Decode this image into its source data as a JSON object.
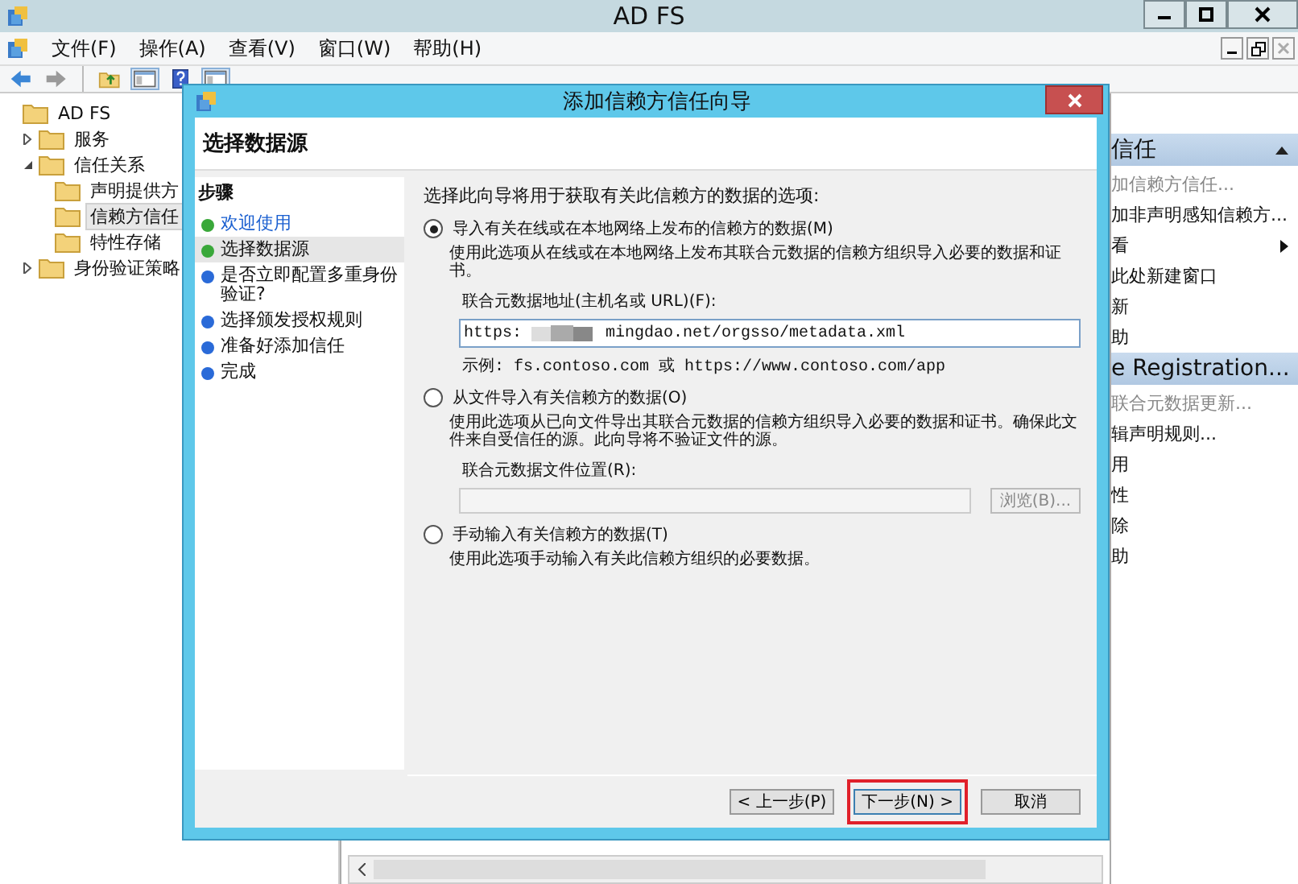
{
  "window": {
    "title": "AD FS"
  },
  "menu": [
    "文件(F)",
    "操作(A)",
    "查看(V)",
    "窗口(W)",
    "帮助(H)"
  ],
  "toolbar": [
    {
      "kind": "back"
    },
    {
      "kind": "forward"
    },
    {
      "kind": "up"
    },
    {
      "kind": "pane"
    },
    {
      "kind": "help"
    },
    {
      "kind": "pane"
    }
  ],
  "tree": [
    {
      "label": "AD FS",
      "selected": false,
      "children": [
        {
          "label": "服务",
          "expanded": false,
          "selected": false
        },
        {
          "label": "信任关系",
          "expanded": true,
          "selected": false,
          "children": [
            {
              "label": "声明提供方",
              "selected": false
            },
            {
              "label": "信赖方信任",
              "selected": true
            },
            {
              "label": "特性存储",
              "selected": false
            }
          ]
        },
        {
          "label": "身份验证策略",
          "expanded": false,
          "selected": false
        }
      ]
    }
  ],
  "actions": [
    {
      "title": "信任",
      "items": [
        {
          "label": "加信赖方信任...",
          "disabled": true,
          "submenu": false
        },
        {
          "label": "加非声明感知信赖方...",
          "disabled": false,
          "submenu": false
        },
        {
          "label": "看",
          "disabled": false,
          "submenu": true
        },
        {
          "label": "此处新建窗口",
          "disabled": false,
          "submenu": false
        },
        {
          "label": "新",
          "disabled": false,
          "submenu": false
        },
        {
          "label": "助",
          "disabled": false,
          "submenu": false
        }
      ]
    },
    {
      "title": "e Registration...",
      "items": [
        {
          "label": "联合元数据更新...",
          "disabled": true,
          "submenu": false
        },
        {
          "label": "辑声明规则...",
          "disabled": false,
          "submenu": false
        },
        {
          "label": "用",
          "disabled": false,
          "submenu": false
        },
        {
          "label": "性",
          "disabled": false,
          "submenu": false
        },
        {
          "label": "除",
          "disabled": false,
          "submenu": false
        },
        {
          "label": "助",
          "disabled": false,
          "submenu": false
        }
      ]
    }
  ],
  "dialog": {
    "title": "添加信赖方信任向导",
    "heading": "选择数据源",
    "steps_title": "步骤",
    "steps": [
      {
        "label": "欢迎使用",
        "color": "#3aa83a",
        "link": true,
        "selected": false
      },
      {
        "label": "选择数据源",
        "color": "#3aa83a",
        "link": false,
        "selected": true
      },
      {
        "label": "是否立即配置多重身份验证?",
        "color": "#2a6ad8",
        "link": false,
        "selected": false
      },
      {
        "label": "选择颁发授权规则",
        "color": "#2a6ad8",
        "link": false,
        "selected": false
      },
      {
        "label": "准备好添加信任",
        "color": "#2a6ad8",
        "link": false,
        "selected": false
      },
      {
        "label": "完成",
        "color": "#2a6ad8",
        "link": false,
        "selected": false
      }
    ],
    "intro": "选择此向导将用于获取有关此信赖方的数据的选项:",
    "options": [
      {
        "kind": "url",
        "label": "导入有关在线或在本地网络上发布的信赖方的数据(M)",
        "selected": true,
        "description": "使用此选项从在线或在本地网络上发布其联合元数据的信赖方组织导入必要的数据和证书。",
        "field_label": "联合元数据地址(主机名或 URL)(F):",
        "value_start": "https:",
        "value_end": "mingdao.net/orgsso/metadata.xml",
        "example": "示例: fs.contoso.com 或 https://www.contoso.com/app"
      },
      {
        "kind": "file",
        "label": "从文件导入有关信赖方的数据(O)",
        "selected": false,
        "description": "使用此选项从已向文件导出其联合元数据的信赖方组织导入必要的数据和证书。确保此文件来自受信任的源。此向导将不验证文件的源。",
        "field_label": "联合元数据文件位置(R):",
        "browse": "浏览(B)...",
        "disabled": true
      },
      {
        "kind": "manual",
        "label": "手动输入有关信赖方的数据(T)",
        "selected": false,
        "description": "使用此选项手动输入有关此信赖方组织的必要数据。"
      }
    ],
    "buttons": [
      {
        "label": "< 上一步(P)",
        "highlighted": false
      },
      {
        "label": "下一步(N) >",
        "highlighted": true
      },
      {
        "label": "取消",
        "highlighted": false
      }
    ]
  }
}
